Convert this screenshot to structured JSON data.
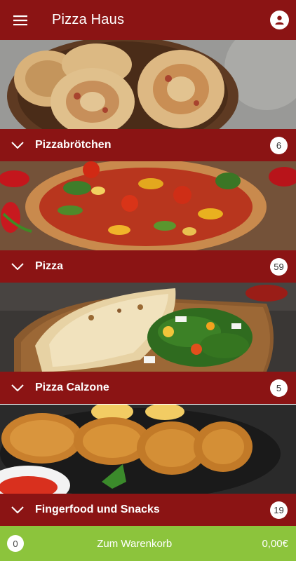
{
  "header": {
    "title": "Pizza Haus",
    "menu_icon": "hamburger-menu-icon",
    "profile_icon": "user-profile-icon"
  },
  "categories": [
    {
      "label": "Pizzabrötchen",
      "count": "6",
      "image": "pizza rolls in a bowl"
    },
    {
      "label": "Pizza",
      "count": "59",
      "image": "pizza with peppers and basil"
    },
    {
      "label": "Pizza Calzone",
      "count": "5",
      "image": "calzone with salad"
    },
    {
      "label": "Fingerfood und Snacks",
      "count": "19",
      "image": "fried chicken with dip"
    }
  ],
  "cart": {
    "count": "0",
    "label": "Zum Warenkorb",
    "total": "0,00€"
  },
  "colors": {
    "primary": "#8b1414",
    "cart": "#8cc43c"
  }
}
